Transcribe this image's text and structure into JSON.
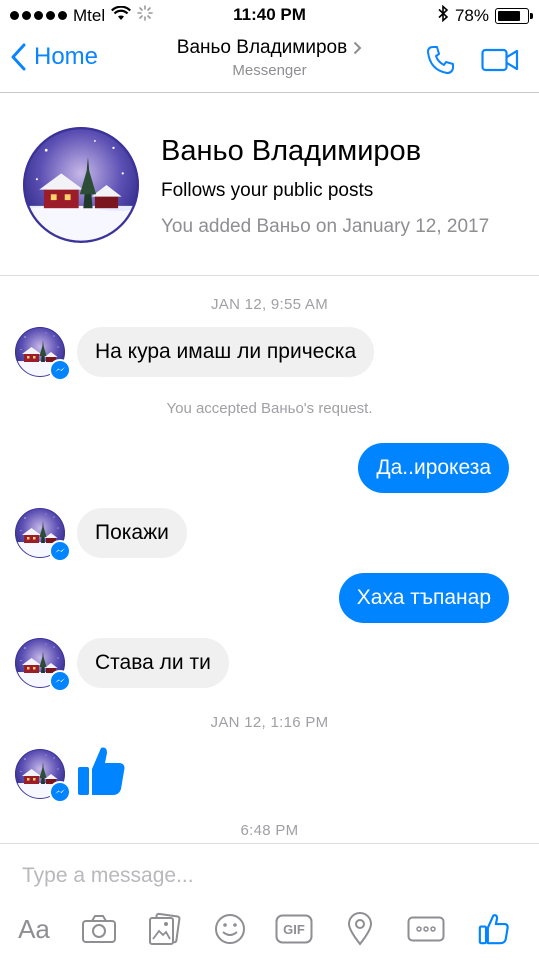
{
  "status_bar": {
    "carrier": "Mtel",
    "time": "11:40 PM",
    "battery": "78%",
    "battery_level": 0.78
  },
  "nav": {
    "back_label": "Home",
    "title": "Ваньо Владимиров",
    "subtitle": "Messenger"
  },
  "profile": {
    "name": "Ваньо Владимиров",
    "line1": "Follows your public posts",
    "line2": "You added Ваньо on January 12, 2017"
  },
  "messages": {
    "ts1": "JAN 12, 9:55 AM",
    "m1": "На кура имаш ли прическа",
    "note1": "You accepted Ваньо's request.",
    "m2": "Да..ирокеза",
    "m3": "Покажи",
    "m4": "Хаха тъпанар",
    "m5": "Става ли ти",
    "ts2": "JAN 12, 1:16 PM",
    "ts3": "6:48 PM"
  },
  "composer": {
    "placeholder": "Type a message...",
    "aa_label": "Aa",
    "gif_label": "GIF"
  },
  "colors": {
    "accent": "#0084ff",
    "nav_blue": "#0a84ff",
    "incoming_bubble": "#f1f0f0",
    "muted_text": "#8e8e93"
  },
  "icons": [
    "wifi-icon",
    "bluetooth-icon",
    "phone-icon",
    "video-icon",
    "messenger-icon",
    "camera-icon",
    "photo-icon",
    "emoji-icon",
    "location-icon",
    "more-icon",
    "thumbs-up-icon"
  ]
}
